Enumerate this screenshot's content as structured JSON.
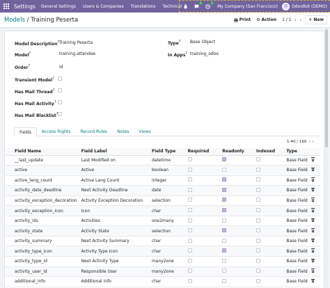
{
  "navbar": {
    "app_name": "Settings",
    "menus": [
      "General Settings",
      "Users & Companies",
      "Translations",
      "Technical"
    ],
    "chat_badge": "5",
    "activity_badge": "3",
    "company": "My Company (San Francisco)",
    "user": "OdooBot (DEMO)",
    "color": "#71639e"
  },
  "control": {
    "breadcrumb_parent": "Models",
    "breadcrumb_sep": " / ",
    "breadcrumb_current": "Training Peserta",
    "print_label": "Print",
    "action_label": "Action",
    "pager": "1 / 1",
    "new_label": "New"
  },
  "form": {
    "model_description_label": "Model Description",
    "model_description_value": "Training Peserta",
    "type_label": "Type",
    "type_value": "Base Object",
    "model_label": "Model",
    "model_value": "training.attendee",
    "in_apps_label": "In Apps",
    "in_apps_value": "training_odoo",
    "order_label": "Order",
    "order_value": "id",
    "transient_label": "Transient Model",
    "has_mail_thread_label": "Has Mail Thread",
    "has_mail_activity_label": "Has Mail Activity",
    "has_mail_blacklist_label": "Has Mail Blacklist"
  },
  "tabs": [
    "Fields",
    "Access Rights",
    "Record Rules",
    "Notes",
    "Views"
  ],
  "list_pager": "1-40 / 160",
  "table": {
    "headers": [
      "Field Name",
      "Field Label",
      "Field Type",
      "Required",
      "Readonly",
      "Indexed",
      "Type"
    ],
    "rows": [
      {
        "name": "__last_update",
        "label": "Last Modified on",
        "ftype": "datetime",
        "required": false,
        "readonly": true,
        "indexed": false,
        "type": "Base Field"
      },
      {
        "name": "active",
        "label": "Active",
        "ftype": "boolean",
        "required": false,
        "readonly": false,
        "indexed": false,
        "type": "Base Field"
      },
      {
        "name": "active_lang_count",
        "label": "Active Lang Count",
        "ftype": "integer",
        "required": false,
        "readonly": true,
        "indexed": false,
        "type": "Base Field"
      },
      {
        "name": "activity_date_deadline",
        "label": "Next Activity Deadline",
        "ftype": "date",
        "required": false,
        "readonly": true,
        "indexed": false,
        "type": "Base Field"
      },
      {
        "name": "activity_exception_decoration",
        "label": "Activity Exception Decoration",
        "ftype": "selection",
        "required": false,
        "readonly": true,
        "indexed": false,
        "type": "Base Field"
      },
      {
        "name": "activity_exception_icon",
        "label": "Icon",
        "ftype": "char",
        "required": false,
        "readonly": true,
        "indexed": false,
        "type": "Base Field"
      },
      {
        "name": "activity_ids",
        "label": "Activities",
        "ftype": "one2many",
        "required": false,
        "readonly": false,
        "indexed": false,
        "type": "Base Field"
      },
      {
        "name": "activity_state",
        "label": "Activity State",
        "ftype": "selection",
        "required": false,
        "readonly": true,
        "indexed": false,
        "type": "Base Field"
      },
      {
        "name": "activity_summary",
        "label": "Next Activity Summary",
        "ftype": "char",
        "required": false,
        "readonly": false,
        "indexed": false,
        "type": "Base Field"
      },
      {
        "name": "activity_type_icon",
        "label": "Activity Type Icon",
        "ftype": "char",
        "required": false,
        "readonly": true,
        "indexed": false,
        "type": "Base Field"
      },
      {
        "name": "activity_type_id",
        "label": "Next Activity Type",
        "ftype": "many2one",
        "required": false,
        "readonly": false,
        "indexed": false,
        "type": "Base Field"
      },
      {
        "name": "activity_user_id",
        "label": "Responsible User",
        "ftype": "many2one",
        "required": false,
        "readonly": false,
        "indexed": false,
        "type": "Base Field"
      },
      {
        "name": "additional_info",
        "label": "Additional info",
        "ftype": "char",
        "required": false,
        "readonly": false,
        "indexed": false,
        "type": "Base Field"
      }
    ]
  }
}
